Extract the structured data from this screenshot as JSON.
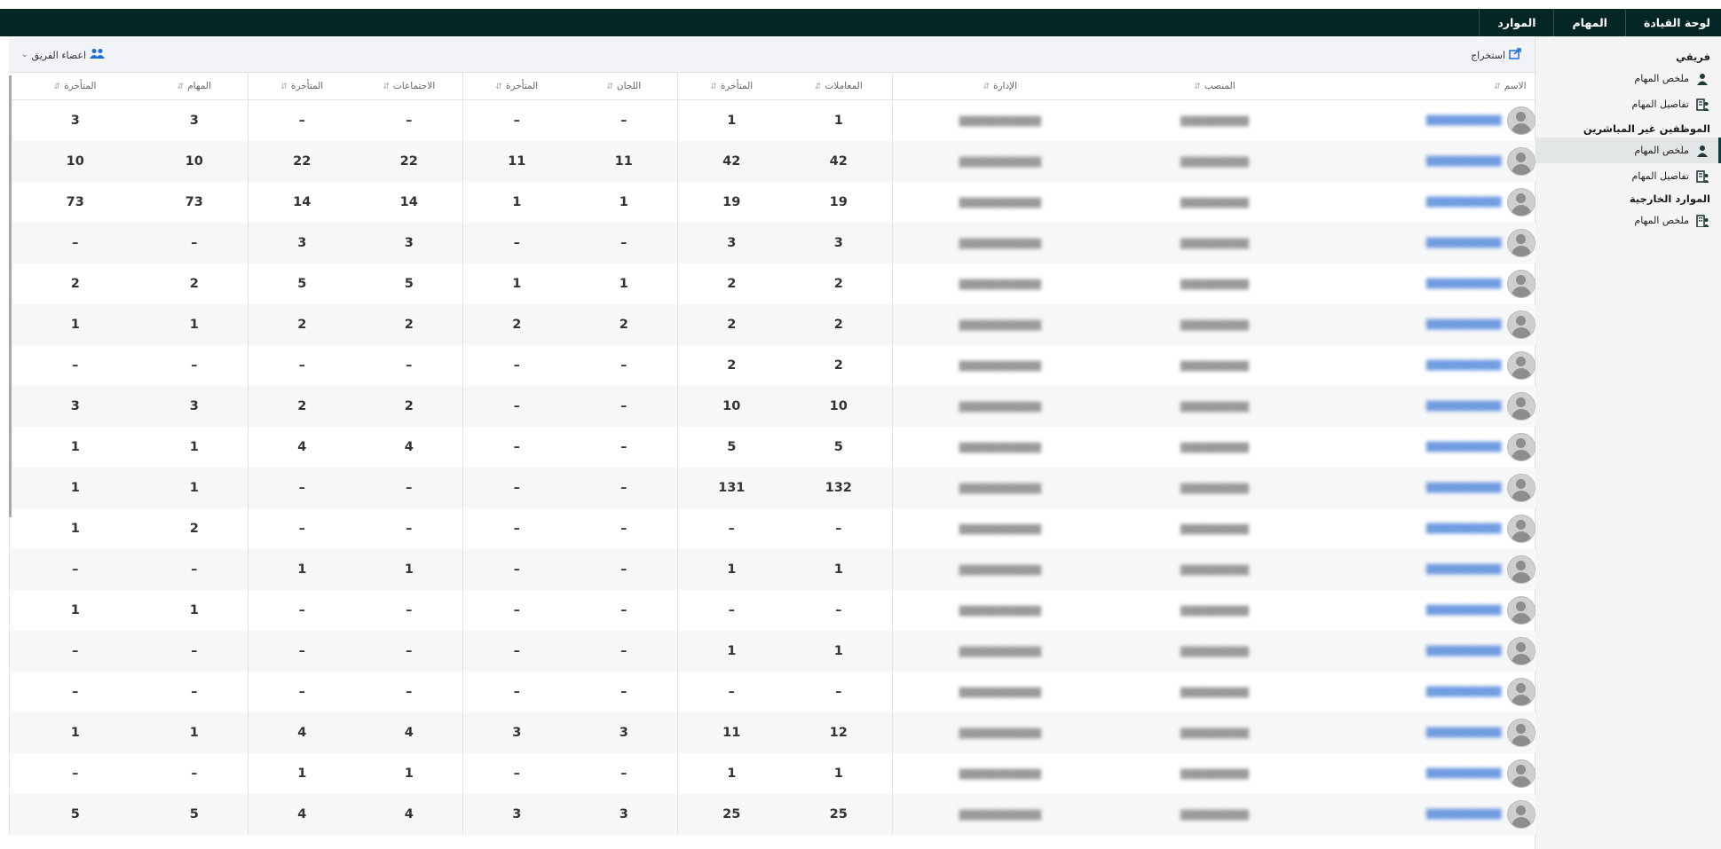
{
  "topnav": [
    "لوحة القيادة",
    "المهام",
    "الموارد"
  ],
  "sidebar": {
    "sections": [
      {
        "heading": "فريقي",
        "items": [
          {
            "label": "ملخص المهام",
            "icon": "person-icon",
            "active": false
          },
          {
            "label": "تفاصيل المهام",
            "icon": "team-details-icon",
            "active": false
          }
        ]
      },
      {
        "heading": "الموظفين غير المباشرين",
        "items": [
          {
            "label": "ملخص المهام",
            "icon": "person-icon",
            "active": true
          },
          {
            "label": "تفاصيل المهام",
            "icon": "team-details-icon",
            "active": false
          }
        ]
      },
      {
        "heading": "الموارد الخارجية",
        "items": [
          {
            "label": "ملخص المهام",
            "icon": "building-icon",
            "active": false
          }
        ]
      }
    ]
  },
  "toolbar": {
    "export_label": "استخراج",
    "team_members_label": "اعضاء الفريق"
  },
  "table": {
    "columns": [
      "الاسم",
      "المنصب",
      "الإدارة",
      "المعاملات",
      "المتأخرة",
      "اللجان",
      "المتأخرة",
      "الاجتماعات",
      "المتأخرة",
      "المهام",
      "المتأخرة"
    ],
    "rows": [
      [
        "1",
        "1",
        "–",
        "–",
        "–",
        "–",
        "3",
        "3"
      ],
      [
        "42",
        "42",
        "11",
        "11",
        "22",
        "22",
        "10",
        "10"
      ],
      [
        "19",
        "19",
        "1",
        "1",
        "14",
        "14",
        "73",
        "73"
      ],
      [
        "3",
        "3",
        "–",
        "–",
        "3",
        "3",
        "–",
        "–"
      ],
      [
        "2",
        "2",
        "1",
        "1",
        "5",
        "5",
        "2",
        "2"
      ],
      [
        "2",
        "2",
        "2",
        "2",
        "2",
        "2",
        "1",
        "1"
      ],
      [
        "2",
        "2",
        "–",
        "–",
        "–",
        "–",
        "–",
        "–"
      ],
      [
        "10",
        "10",
        "–",
        "–",
        "2",
        "2",
        "3",
        "3"
      ],
      [
        "5",
        "5",
        "–",
        "–",
        "4",
        "4",
        "1",
        "1"
      ],
      [
        "132",
        "131",
        "–",
        "–",
        "–",
        "–",
        "1",
        "1"
      ],
      [
        "–",
        "–",
        "–",
        "–",
        "–",
        "–",
        "2",
        "1"
      ],
      [
        "1",
        "1",
        "–",
        "–",
        "1",
        "1",
        "–",
        "–"
      ],
      [
        "–",
        "–",
        "–",
        "–",
        "–",
        "–",
        "1",
        "1"
      ],
      [
        "1",
        "1",
        "–",
        "–",
        "–",
        "–",
        "–",
        "–"
      ],
      [
        "–",
        "–",
        "–",
        "–",
        "–",
        "–",
        "–",
        "–"
      ],
      [
        "12",
        "11",
        "3",
        "3",
        "4",
        "4",
        "1",
        "1"
      ],
      [
        "1",
        "1",
        "–",
        "–",
        "1",
        "1",
        "–",
        "–"
      ],
      [
        "25",
        "25",
        "3",
        "3",
        "4",
        "4",
        "5",
        "5"
      ]
    ]
  },
  "colors": {
    "topbar": "#042624",
    "accent": "#1d6fd6",
    "sidebar_active_border": "#0f3f3c"
  }
}
